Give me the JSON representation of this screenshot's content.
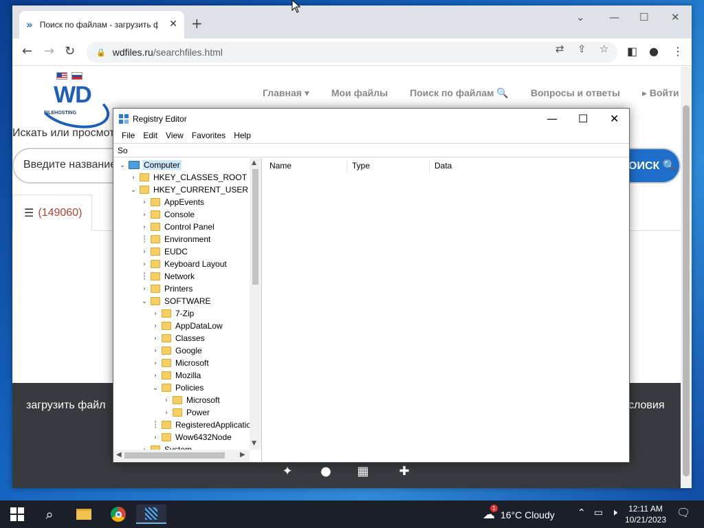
{
  "browser": {
    "tab_title": "Поиск по файлам - загрузить ф",
    "url_domain": "wdfiles.ru",
    "url_path": "/searchfiles.html"
  },
  "site": {
    "logo_text": "WD",
    "logo_sub": "FILEHOSTING",
    "nav": [
      "Главная ▾",
      "Мои файлы",
      "Поиск по файлам 🔍",
      "Вопросы и ответы",
      "▸ Войти"
    ],
    "search_label": "Искать или просмот",
    "search_placeholder": "Введите название",
    "search_button": "ОИСК 🔍",
    "count": "(149060)",
    "footer_left": "загрузить файл",
    "footer_right": "словия"
  },
  "regedit": {
    "title": "Registry Editor",
    "menu": [
      "File",
      "Edit",
      "View",
      "Favorites",
      "Help"
    ],
    "address": "So",
    "columns": [
      "Name",
      "Type",
      "Data"
    ],
    "tree": [
      {
        "label": "Computer",
        "level": 0,
        "toggle": "v",
        "icon": "computer",
        "selected": true
      },
      {
        "label": "HKEY_CLASSES_ROOT",
        "level": 1,
        "toggle": ">",
        "icon": "folder"
      },
      {
        "label": "HKEY_CURRENT_USER",
        "level": 1,
        "toggle": "v",
        "icon": "folder"
      },
      {
        "label": "AppEvents",
        "level": 2,
        "toggle": ">",
        "icon": "folder"
      },
      {
        "label": "Console",
        "level": 2,
        "toggle": ">",
        "icon": "folder"
      },
      {
        "label": "Control Panel",
        "level": 2,
        "toggle": ">",
        "icon": "folder"
      },
      {
        "label": "Environment",
        "level": 2,
        "toggle": "",
        "icon": "folder"
      },
      {
        "label": "EUDC",
        "level": 2,
        "toggle": ">",
        "icon": "folder"
      },
      {
        "label": "Keyboard Layout",
        "level": 2,
        "toggle": ">",
        "icon": "folder"
      },
      {
        "label": "Network",
        "level": 2,
        "toggle": "",
        "icon": "folder"
      },
      {
        "label": "Printers",
        "level": 2,
        "toggle": ">",
        "icon": "folder"
      },
      {
        "label": "SOFTWARE",
        "level": 2,
        "toggle": "v",
        "icon": "folder"
      },
      {
        "label": "7-Zip",
        "level": 3,
        "toggle": ">",
        "icon": "folder"
      },
      {
        "label": "AppDataLow",
        "level": 3,
        "toggle": ">",
        "icon": "folder"
      },
      {
        "label": "Classes",
        "level": 3,
        "toggle": ">",
        "icon": "folder"
      },
      {
        "label": "Google",
        "level": 3,
        "toggle": ">",
        "icon": "folder"
      },
      {
        "label": "Microsoft",
        "level": 3,
        "toggle": ">",
        "icon": "folder"
      },
      {
        "label": "Mozilla",
        "level": 3,
        "toggle": ">",
        "icon": "folder"
      },
      {
        "label": "Policies",
        "level": 3,
        "toggle": "v",
        "icon": "folder"
      },
      {
        "label": "Microsoft",
        "level": 4,
        "toggle": ">",
        "icon": "folder"
      },
      {
        "label": "Power",
        "level": 4,
        "toggle": ">",
        "icon": "folder"
      },
      {
        "label": "RegisteredApplicatic",
        "level": 3,
        "toggle": "",
        "icon": "folder"
      },
      {
        "label": "Wow6432Node",
        "level": 3,
        "toggle": ">",
        "icon": "folder"
      },
      {
        "label": "System",
        "level": 2,
        "toggle": ">",
        "icon": "folder"
      }
    ]
  },
  "taskbar": {
    "weather": "16°C  Cloudy",
    "weather_badge": "1",
    "time": "12:11 AM",
    "date": "10/21/2023"
  }
}
